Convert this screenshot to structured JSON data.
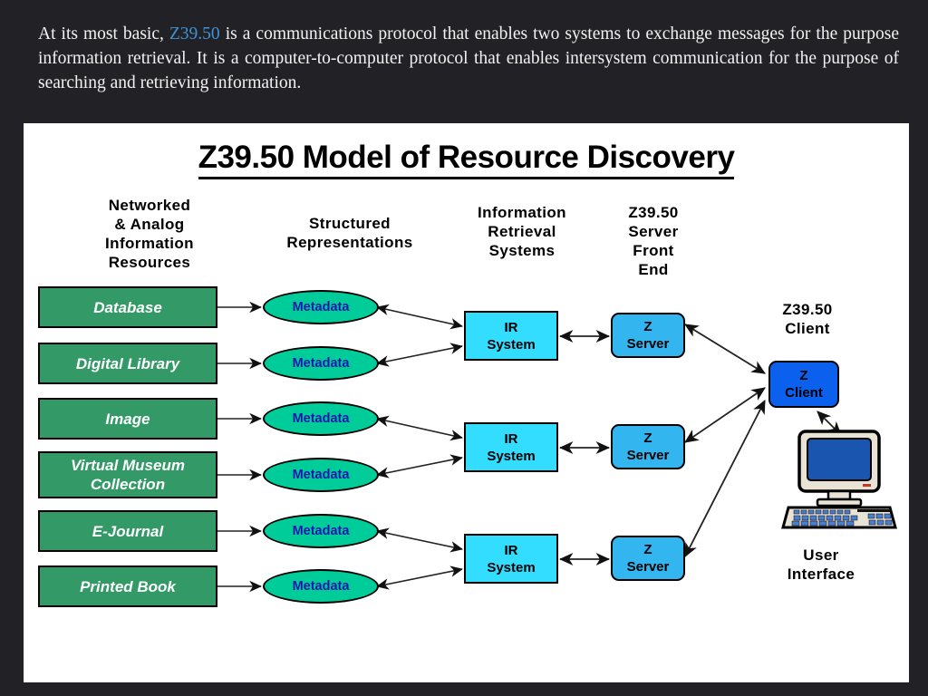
{
  "intro": {
    "before": "At its most basic, ",
    "highlight": "Z39.50",
    "after": " is a communications protocol that enables two systems to exchange messages for the purpose information retrieval.   It is a computer-to-computer protocol that enables intersystem communication for the purpose of searching and retrieving information.",
    "highlight_color": "#3d93d6"
  },
  "diagram": {
    "title": "Z39.50 Model of Resource Discovery",
    "headers": {
      "resources": "Networked\n& Analog\nInformation\nResources",
      "structured": "Structured\nRepresentations",
      "ir_systems": "Information\nRetrieval\nSystems",
      "server_front_end": "Z39.50\nServer\nFront\nEnd",
      "client": "Z39.50\nClient",
      "user_interface": "User\nInterface"
    },
    "colors": {
      "resource_box": "#339966",
      "metadata_ellipse": "#00cc99",
      "metadata_text": "#1818b0",
      "ir_box": "#33ddff",
      "z_server": "#33b5f0",
      "z_client": "#0b61ee",
      "panel_background": "#ffffff",
      "slide_background": "#222226"
    },
    "resources": [
      {
        "label": "Database"
      },
      {
        "label": "Digital Library"
      },
      {
        "label": "Image"
      },
      {
        "label": "Virtual Museum\nCollection"
      },
      {
        "label": "E-Journal"
      },
      {
        "label": "Printed Book"
      }
    ],
    "metadata_nodes": [
      {
        "label": "Metadata"
      },
      {
        "label": "Metadata"
      },
      {
        "label": "Metadata"
      },
      {
        "label": "Metadata"
      },
      {
        "label": "Metadata"
      },
      {
        "label": "Metadata"
      }
    ],
    "ir_systems": [
      {
        "line1": "IR",
        "line2": "System"
      },
      {
        "line1": "IR",
        "line2": "System"
      },
      {
        "line1": "IR",
        "line2": "System"
      }
    ],
    "z_servers": [
      {
        "line1": "Z",
        "line2": "Server"
      },
      {
        "line1": "Z",
        "line2": "Server"
      },
      {
        "line1": "Z",
        "line2": "Server"
      }
    ],
    "z_client": {
      "line1": "Z",
      "line2": "Client"
    }
  }
}
